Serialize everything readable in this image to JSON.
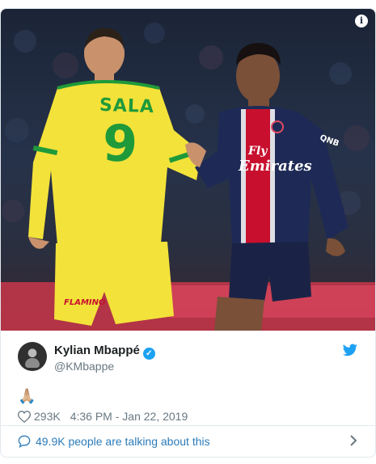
{
  "photo": {
    "info_label": "i",
    "left_player": {
      "shirt_name": "SALA",
      "shirt_number": "9",
      "shorts_sponsor": "FLAMINO"
    },
    "right_player": {
      "sponsor_line1": "Fly",
      "sponsor_line2": "Emirates",
      "sleeve_text": "QNB"
    }
  },
  "tweet": {
    "author_name": "Kylian Mbappé",
    "author_handle": "@KMbappe",
    "verified_glyph": "✓",
    "body_emoji": "🙏🏼",
    "like_count": "293K",
    "timestamp": "4:36 PM - Jan 22, 2019"
  },
  "footer": {
    "talking_text": "49.9K people are talking about this"
  },
  "colors": {
    "twitter_blue": "#1da1f2",
    "link_blue": "#2b7bb9",
    "muted_text": "#697882",
    "nantes_yellow": "#f3e23a",
    "psg_navy": "#1e2a55"
  },
  "icons": [
    "info-icon",
    "verified-badge-icon",
    "twitter-bird-icon",
    "heart-icon",
    "speech-bubble-icon",
    "chevron-right-icon"
  ]
}
